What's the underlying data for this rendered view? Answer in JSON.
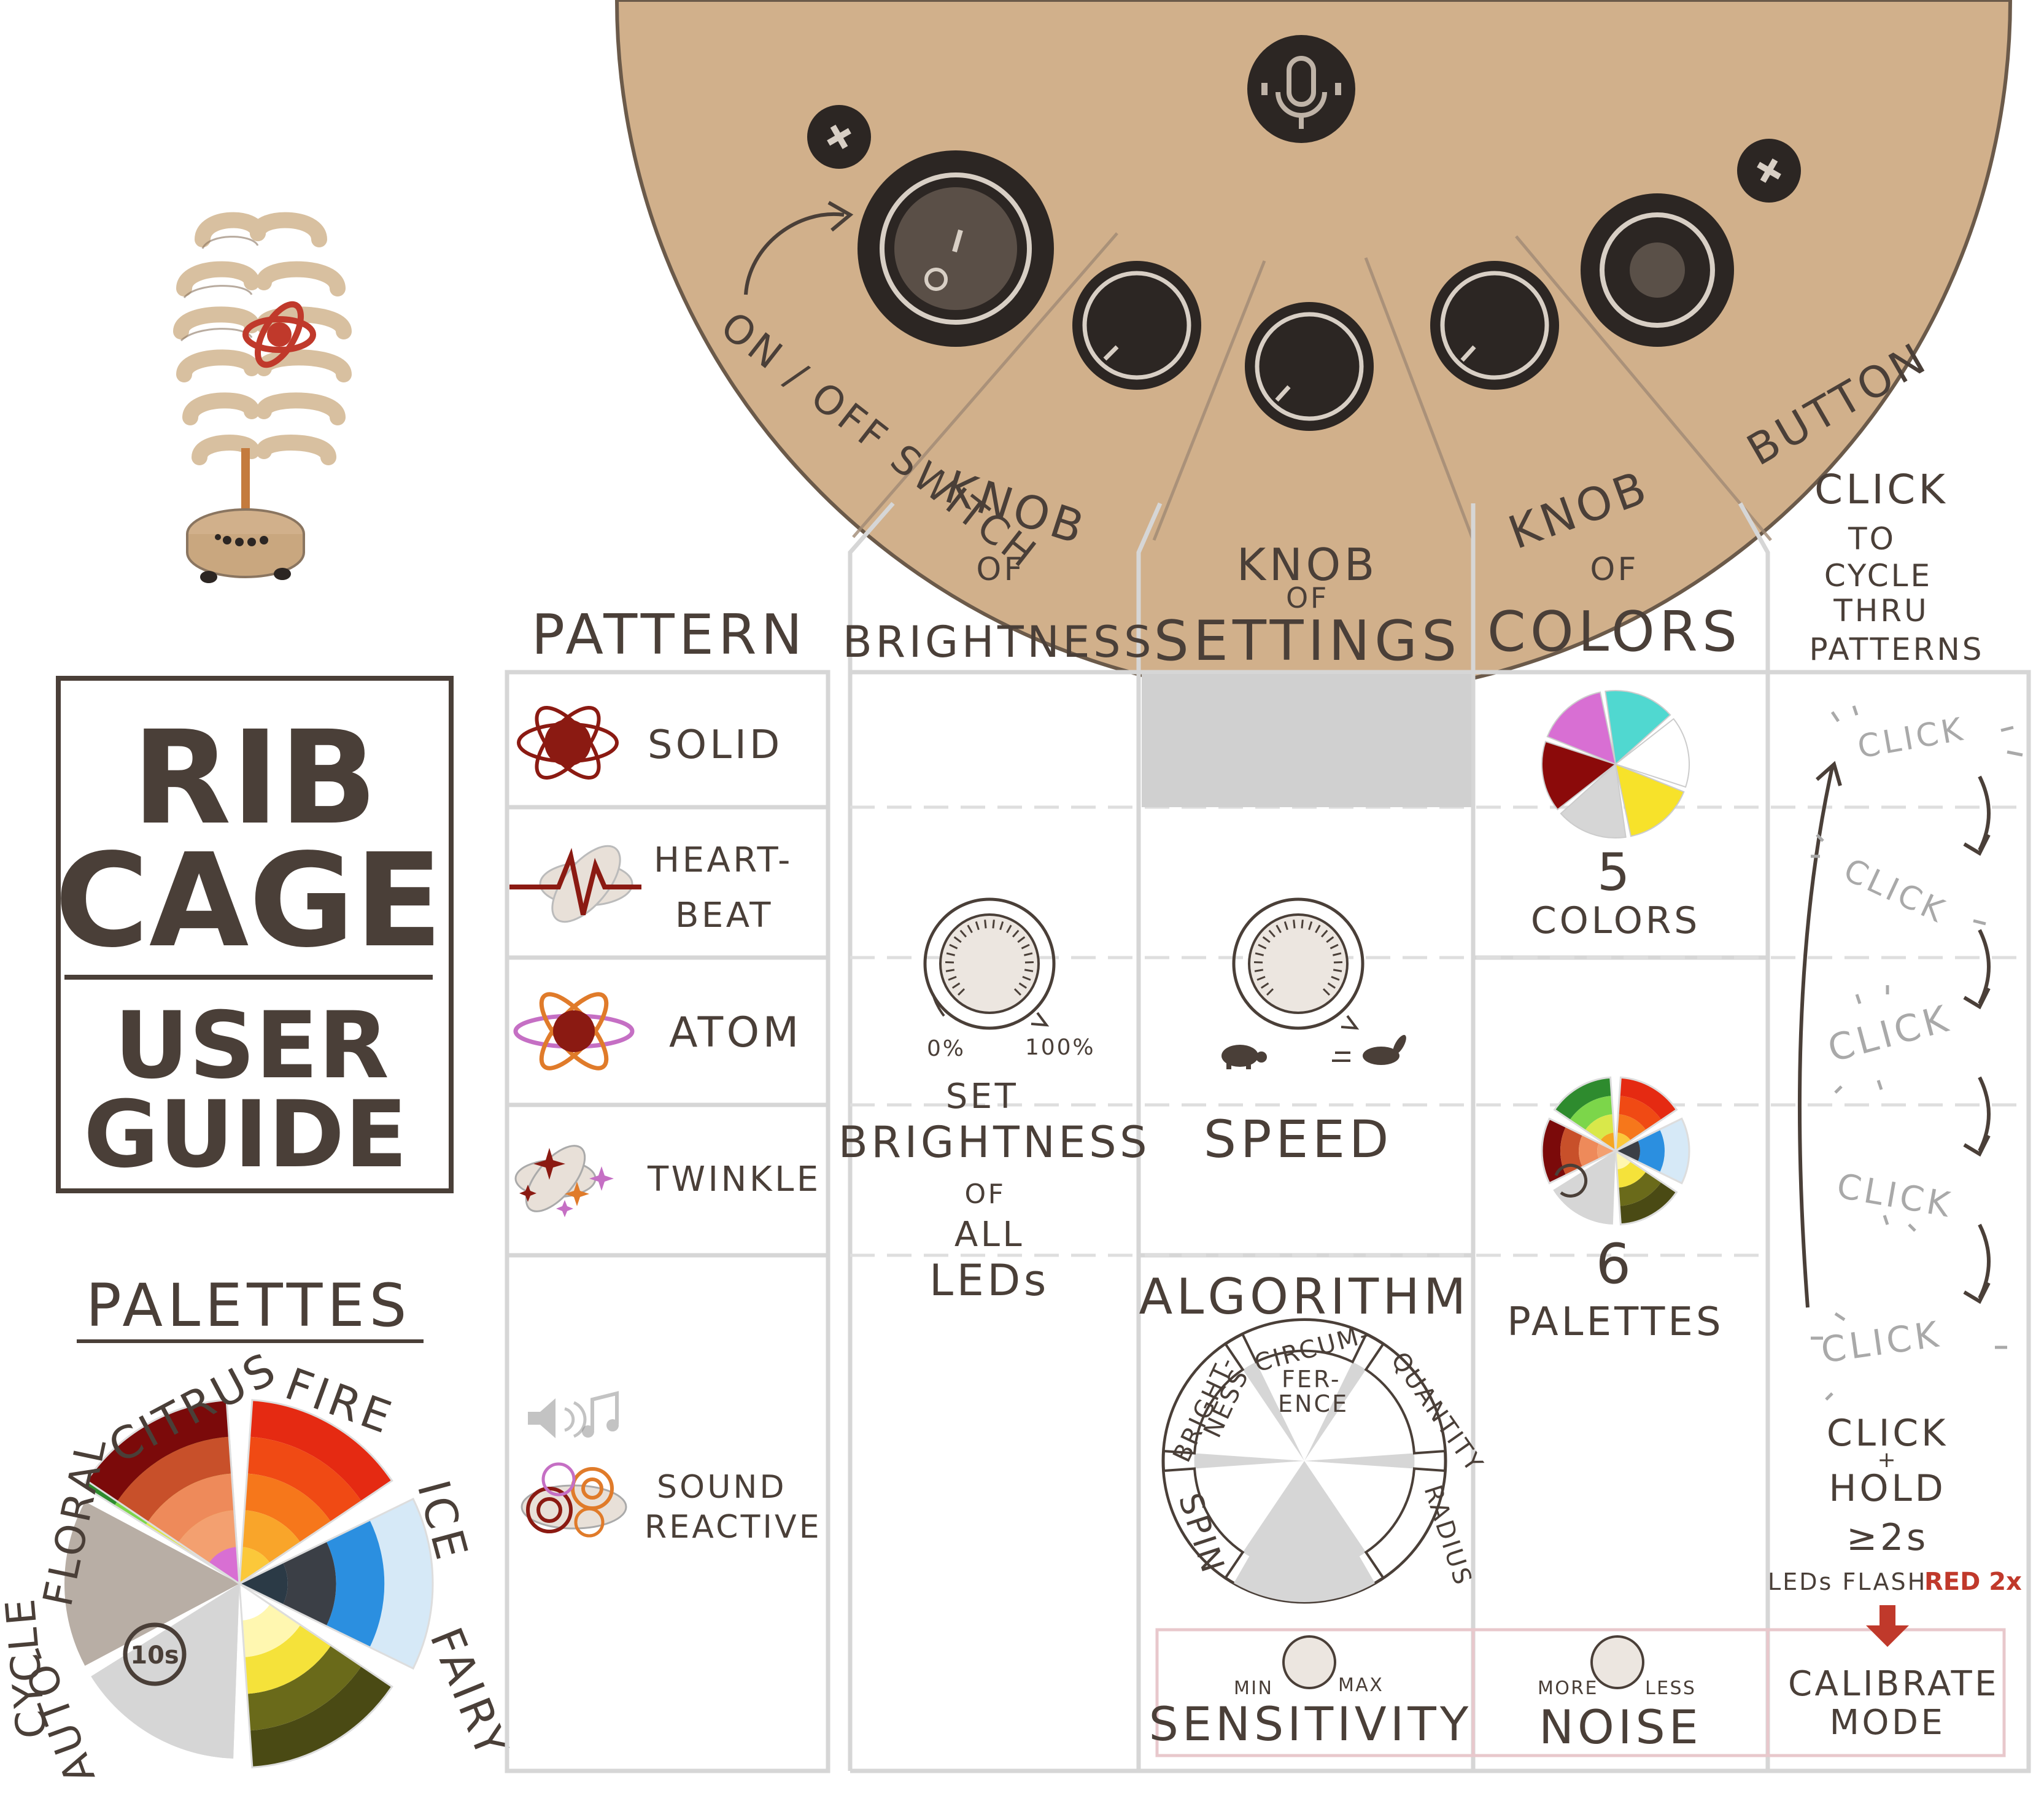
{
  "title": {
    "line1": "RIB",
    "line2": "CAGE",
    "line3": "USER",
    "line4": "GUIDE"
  },
  "device_labels": {
    "switch": "ON / OFF SWITCH",
    "button": "BUTTON"
  },
  "columns": {
    "pattern": "PATTERN",
    "brightness": {
      "line1": "KNOB",
      "line2": "OF",
      "line3": "BRIGHTNESS"
    },
    "settings": {
      "line1": "KNOB",
      "line2": "OF",
      "line3": "SETTINGS"
    },
    "colors": {
      "line1": "KNOB",
      "line2": "OF",
      "line3": "COLORS"
    },
    "button": {
      "line1": "CLICK",
      "line2": "TO",
      "line3": "CYCLE",
      "line4": "THRU",
      "line5": "PATTERNS"
    }
  },
  "patterns": [
    {
      "label": "SOLID"
    },
    {
      "label": "HEART-",
      "label2": "BEAT"
    },
    {
      "label": "ATOM"
    },
    {
      "label": "TWINKLE"
    },
    {
      "label": "SOUND",
      "label2": "REACTIVE"
    }
  ],
  "brightness": {
    "min": "0%",
    "max": "100%",
    "line1": "SET",
    "line2": "BRIGHTNESS",
    "line3": "OF",
    "line4": "ALL",
    "line5": "LEDs"
  },
  "speed": {
    "label": "SPEED"
  },
  "algorithm": {
    "title": "ALGORITHM",
    "segments": [
      "BRIGHT-",
      "NESS",
      "CIRCUM-",
      "FER-",
      "ENCE",
      "QUANTITY",
      "RADIUS",
      "SPIN"
    ]
  },
  "colors": {
    "five_num": "5",
    "five_label": "COLORS",
    "six_num": "6",
    "six_label": "PALETTES"
  },
  "click_word": "CLICK",
  "hold": {
    "line1": "CLICK",
    "line2": "+",
    "line3": "HOLD",
    "line4": "≥2s",
    "flash": "LEDs FLASH",
    "flash_red": "RED 2x"
  },
  "calibrate": {
    "line1": "CALIBRATE",
    "line2": "MODE"
  },
  "sensitivity": {
    "min": "MIN",
    "max": "MAX",
    "label": "SENSITIVITY"
  },
  "noise": {
    "more": "MORE",
    "less": "LESS",
    "label": "NOISE"
  },
  "palettes": {
    "title": "PALETTES",
    "names": [
      "CITRUS",
      "FIRE",
      "ICE",
      "FAIRY",
      "AUTO-",
      "CYCLE",
      "FLORAL"
    ],
    "auto_badge": "10s"
  },
  "colors_hex": {
    "wood": "#d1b08b",
    "ink": "#4a3f38",
    "dark_red": "#8b1a12",
    "accent_red": "#c0392b",
    "grey": "#d9d9d9"
  }
}
